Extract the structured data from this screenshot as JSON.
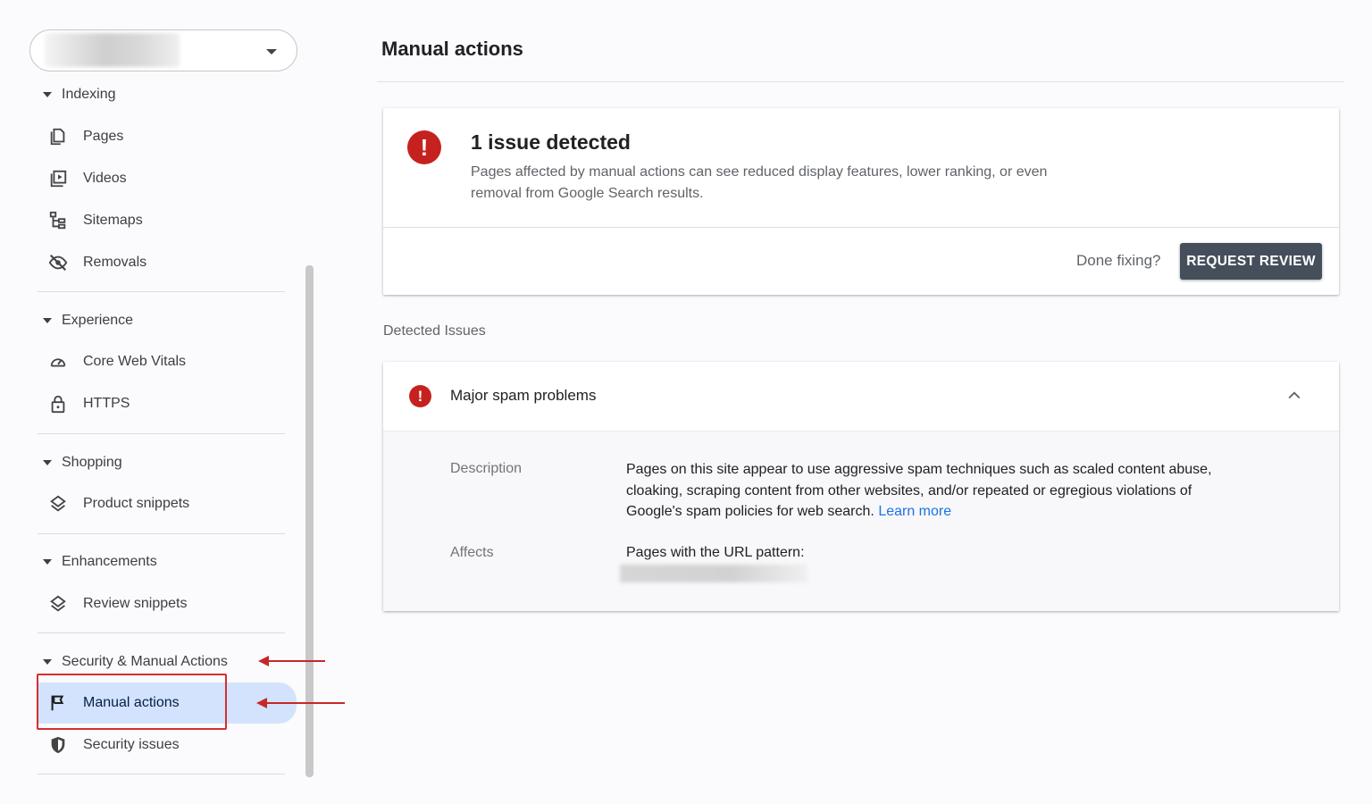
{
  "sidebar": {
    "property_selector": {
      "value": ""
    },
    "sections": [
      {
        "header": "Indexing",
        "items": [
          {
            "label": "Pages",
            "icon": "pages-icon"
          },
          {
            "label": "Videos",
            "icon": "videos-icon"
          },
          {
            "label": "Sitemaps",
            "icon": "sitemaps-icon"
          },
          {
            "label": "Removals",
            "icon": "removals-icon"
          }
        ]
      },
      {
        "header": "Experience",
        "items": [
          {
            "label": "Core Web Vitals",
            "icon": "speedometer-icon"
          },
          {
            "label": "HTTPS",
            "icon": "lock-icon"
          }
        ]
      },
      {
        "header": "Shopping",
        "items": [
          {
            "label": "Product snippets",
            "icon": "layers-icon"
          }
        ]
      },
      {
        "header": "Enhancements",
        "items": [
          {
            "label": "Review snippets",
            "icon": "layers-icon"
          }
        ]
      },
      {
        "header": "Security & Manual Actions",
        "items": [
          {
            "label": "Manual actions",
            "icon": "flag-icon",
            "active": true
          },
          {
            "label": "Security issues",
            "icon": "shield-icon"
          }
        ]
      }
    ]
  },
  "main": {
    "title": "Manual actions",
    "summary": {
      "title": "1 issue detected",
      "description": "Pages affected by manual actions can see reduced display features, lower ranking, or even removal from Google Search results.",
      "done_fixing": "Done fixing?",
      "request_review": "REQUEST REVIEW"
    },
    "detected_issues_label": "Detected Issues",
    "issue": {
      "title": "Major spam problems",
      "description_label": "Description",
      "description": "Pages on this site appear to use aggressive spam techniques such as scaled content abuse, cloaking, scraping content from other websites, and/or repeated or egregious violations of Google's spam policies for web search.",
      "learn_more": "Learn more",
      "affects_label": "Affects",
      "affects_value": "Pages with the URL pattern:"
    }
  },
  "colors": {
    "alert": "#c5221f",
    "active_nav": "#d3e3fd",
    "button": "#454f5b",
    "link": "#1a73e8",
    "annotation": "#c62828"
  }
}
